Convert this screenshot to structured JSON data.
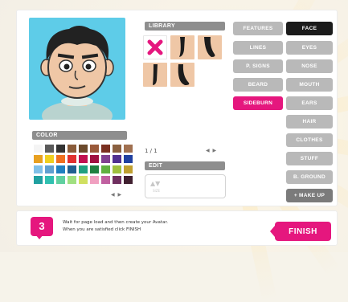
{
  "color_panel": {
    "label": "COLOR",
    "swatches": [
      "#f4f4f4",
      "#5a5a5a",
      "#333333",
      "#8a5c3a",
      "#6b4a2c",
      "#9a5a3a",
      "#7a3020",
      "#8a6040",
      "#a07050",
      "#e8a020",
      "#f0d020",
      "#f07020",
      "#e03030",
      "#c01050",
      "#a01040",
      "#804090",
      "#503090",
      "#2040a0",
      "#80c0e8",
      "#60a0d0",
      "#2080c0",
      "#206090",
      "#20a080",
      "#208040",
      "#60b040",
      "#a0c040",
      "#c0a030",
      "#20a0a0",
      "#30c0b0",
      "#60d0a0",
      "#a0e080",
      "#d0e060",
      "#f0a0c0",
      "#c060a0",
      "#703060",
      "#402030"
    ],
    "pager": "◀ ▶"
  },
  "library": {
    "label": "LIBRARY",
    "counter": "1 / 1",
    "pager": "◀ ▶",
    "items": [
      "remove-icon",
      "sideburn-1",
      "sideburn-2",
      "sideburn-3",
      "sideburn-4"
    ]
  },
  "edit": {
    "label": "EDIT",
    "arrows": "▲▼",
    "sub": "SIZE"
  },
  "feature_tabs": [
    {
      "label": "FEATURES",
      "state": "grey"
    },
    {
      "label": "LINES",
      "state": "grey"
    },
    {
      "label": "P. SIGNS",
      "state": "grey"
    },
    {
      "label": "BEARD",
      "state": "grey"
    },
    {
      "label": "SIDEBURN",
      "state": "active"
    }
  ],
  "category_tabs": [
    {
      "label": "FACE",
      "state": "active"
    },
    {
      "label": "EYES",
      "state": "grey"
    },
    {
      "label": "NOSE",
      "state": "grey"
    },
    {
      "label": "MOUTH",
      "state": "grey"
    },
    {
      "label": "EARS",
      "state": "grey"
    },
    {
      "label": "HAIR",
      "state": "grey"
    },
    {
      "label": "CLOTHES",
      "state": "grey"
    },
    {
      "label": "STUFF",
      "state": "grey"
    },
    {
      "label": "B. GROUND",
      "state": "grey"
    },
    {
      "label": "+ MAKE UP",
      "state": "dark"
    }
  ],
  "footer": {
    "step": "3",
    "instruction_line1": "Wait for page load and then create your Avatar.",
    "instruction_line2": "When you are satisfied click FINISH",
    "finish_label": "FINISH"
  },
  "colors": {
    "accent": "#e5177e",
    "avatar_bg": "#5ecce8",
    "skin": "#efc7a6"
  }
}
